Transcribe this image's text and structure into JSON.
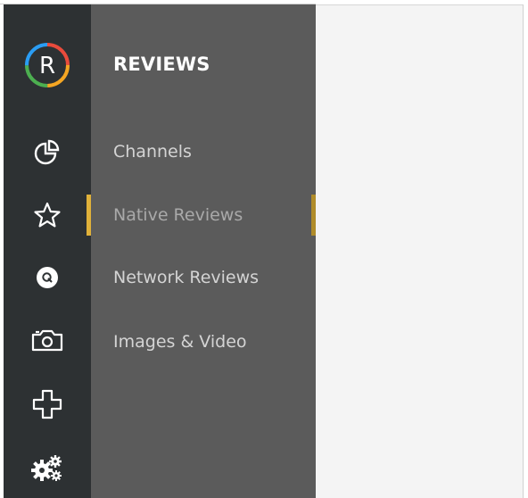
{
  "panel": {
    "title": "REVIEWS"
  },
  "logo": {
    "letter": "R",
    "ring_colors": [
      "#e94b3c",
      "#f5a623",
      "#4caf50",
      "#2a9df4"
    ]
  },
  "rail": {
    "icons": [
      "dashboard-pie-icon",
      "star-icon",
      "q-circle-icon",
      "camera-icon",
      "plus-cross-icon",
      "settings-gears-icon"
    ]
  },
  "menu": {
    "items": [
      {
        "label": "Channels",
        "active": false
      },
      {
        "label": "Native Reviews",
        "active": true
      },
      {
        "label": "Network Reviews",
        "active": false
      },
      {
        "label": "Images & Video",
        "active": false
      }
    ]
  },
  "colors": {
    "rail_bg": "#2d3133",
    "panel_bg": "#5b5b5b",
    "accent": "#e0b13a",
    "content_bg": "#f4f4f4"
  }
}
